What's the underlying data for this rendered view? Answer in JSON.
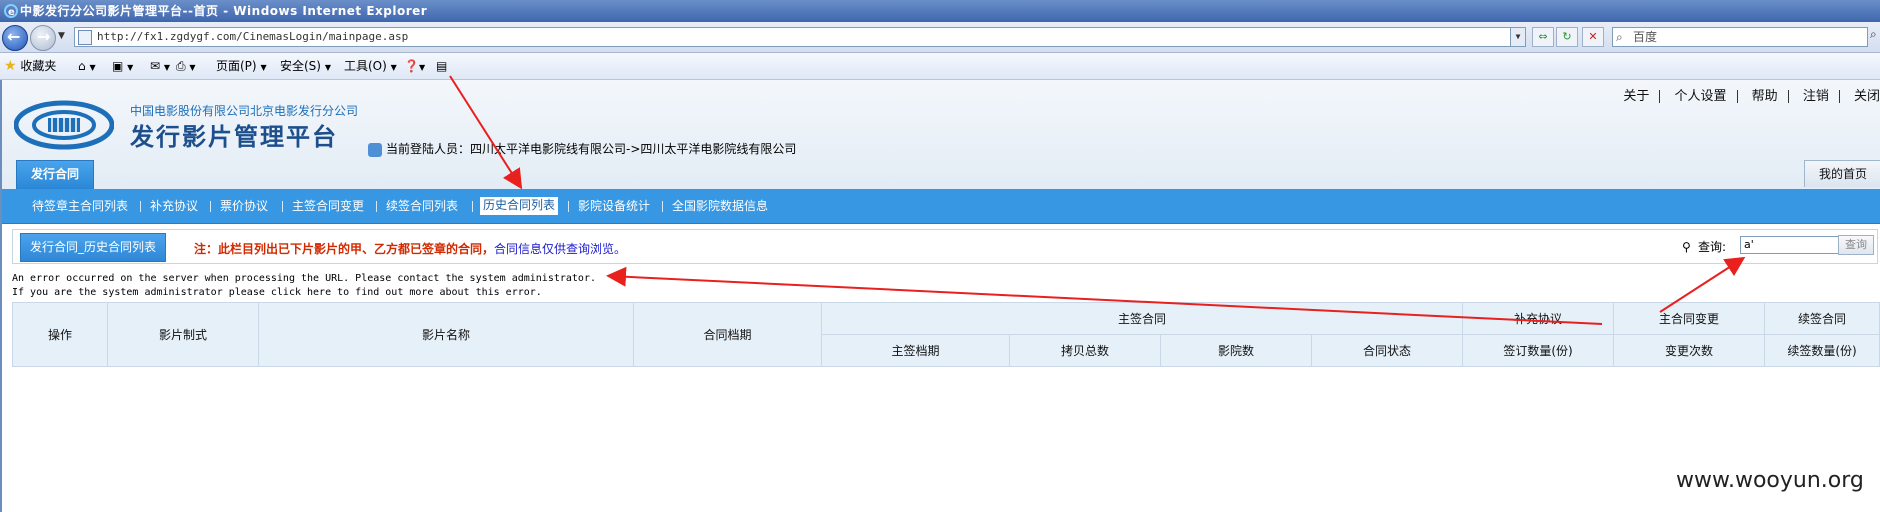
{
  "window": {
    "title": "中影发行分公司影片管理平台--首页 - Windows Internet Explorer"
  },
  "browser": {
    "url": "http://fx1.zgdygf.com/CinemasLogin/mainpage.asp",
    "search_placeholder": "百度",
    "command_bar": {
      "favorites": "收藏夹",
      "page": "页面(P)",
      "safety": "安全(S)",
      "tools": "工具(O)"
    }
  },
  "header": {
    "company": "中国电影股份有限公司北京电影发行分公司",
    "platform": "发行影片管理平台",
    "login_user": "当前登陆人员：四川太平洋电影院线有限公司->四川太平洋电影院线有限公司",
    "top_links": [
      "关于",
      "个人设置",
      "帮助",
      "注销",
      "关闭"
    ],
    "tab_main": "发行合同",
    "tab_home": "我的首页"
  },
  "menu": {
    "items": [
      "待签章主合同列表",
      "补充协议",
      "票价协议",
      "主签合同变更",
      "续签合同列表",
      "历史合同列表",
      "影院设备统计",
      "全国影院数据信息"
    ],
    "active_index": 5
  },
  "subheader": {
    "tab": "发行合同_历史合同列表",
    "note_prefix": "注：",
    "note_red": "此栏目列出已下片影片的甲、乙方都已签章的合同，",
    "note_blue": "合同信息仅供查询浏览。",
    "query_label": "查询:",
    "query_value": "a'",
    "query_button": "查询"
  },
  "error": {
    "line1": "An error occurred on the server when processing the URL. Please contact the system administrator.",
    "line2": "If you are the system administrator please click here to find out more about this error."
  },
  "table": {
    "top_headers": [
      "操作",
      "影片制式",
      "影片名称",
      "合同档期",
      "主签合同",
      "补充协议",
      "主合同变更",
      "续签合同"
    ],
    "sub_headers": [
      "主签档期",
      "拷贝总数",
      "影院数",
      "合同状态",
      "签订数量(份)",
      "变更次数",
      "续签数量(份)"
    ]
  },
  "watermark": "www.wooyun.org",
  "colors": {
    "menu_bar": "#3797e2",
    "arrow": "#e8201e",
    "note_red": "#d12a00",
    "note_blue": "#1a1ad0"
  }
}
